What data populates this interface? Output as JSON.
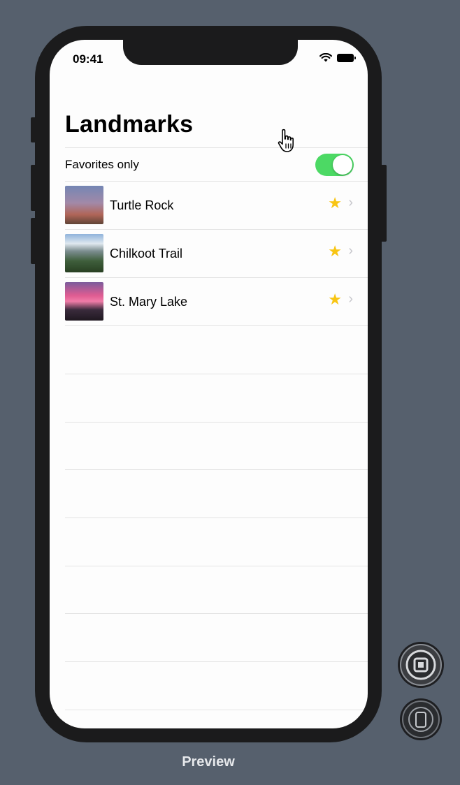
{
  "status_bar": {
    "time": "09:41",
    "wifi_icon": "wifi-icon",
    "battery_icon": "battery-icon"
  },
  "nav": {
    "title": "Landmarks"
  },
  "favorites_toggle": {
    "label": "Favorites only",
    "on": true,
    "on_color": "#4cd964"
  },
  "landmarks": [
    {
      "name": "Turtle Rock",
      "favorite": true
    },
    {
      "name": "Chilkoot Trail",
      "favorite": true
    },
    {
      "name": "St. Mary Lake",
      "favorite": true
    }
  ],
  "footer": {
    "label": "Preview"
  },
  "colors": {
    "star": "#f8c513",
    "background": "#56606d",
    "device": "#1b1b1c"
  }
}
